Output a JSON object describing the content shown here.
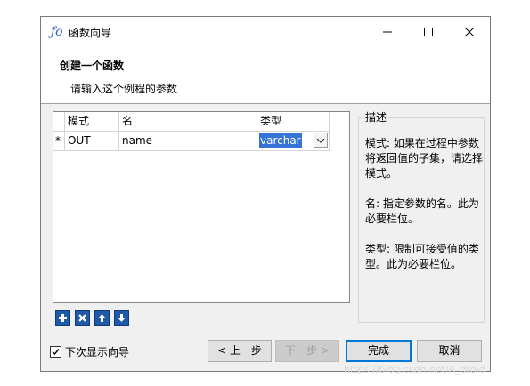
{
  "window": {
    "title": "函数向导",
    "app_icon_glyph": "ƒo"
  },
  "header": {
    "title": "创建一个函数",
    "subtitle": "请输入这个例程的参数"
  },
  "grid": {
    "columns": [
      "模式",
      "名",
      "类型"
    ],
    "rows": [
      {
        "marker": "*",
        "mode": "OUT",
        "name": "name",
        "type": "varchar"
      }
    ]
  },
  "description": {
    "legend": "描述",
    "paragraphs": [
      "模式: 如果在过程中参数将返回值的子集，请选择模式。",
      "名: 指定参数的名。此为必要栏位。",
      "类型: 限制可接受值的类型。此为必要栏位。"
    ]
  },
  "footer": {
    "show_wizard_label": "下次显示向导",
    "show_wizard_checked": true,
    "prev_label": "< 上一步",
    "next_label": "下一步 >",
    "finish_label": "完成",
    "cancel_label": "取消"
  },
  "watermark": "https://blog.csdn.net/A_droid",
  "colors": {
    "selection": "#3574d6",
    "tool_button": "#1f5aa8",
    "default_button_border": "#0078d7"
  },
  "icons": [
    "function-icon",
    "minimize-icon",
    "maximize-icon",
    "close-icon",
    "chevron-down-icon",
    "add-icon",
    "delete-icon",
    "move-up-icon",
    "move-down-icon",
    "checkmark-icon"
  ]
}
